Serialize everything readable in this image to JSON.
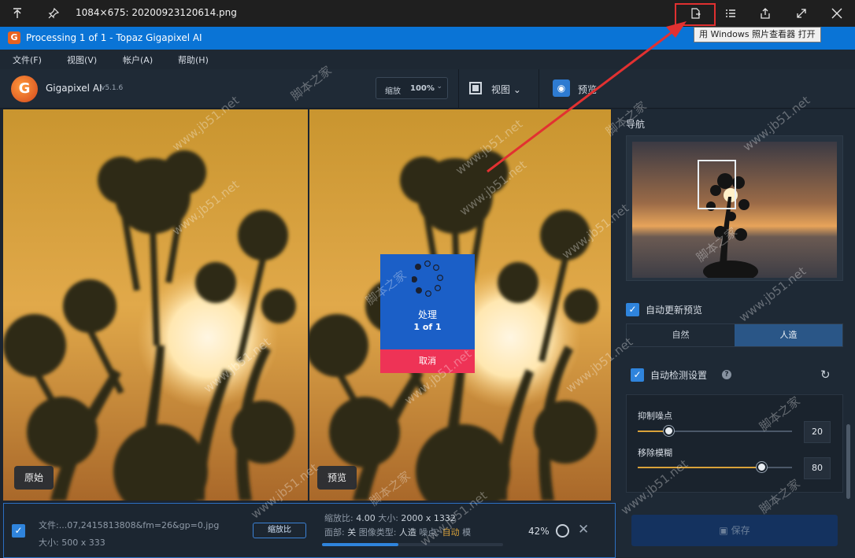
{
  "viewer": {
    "title": "1084×675: 20200923120614.png",
    "tooltip": "用 Windows 照片查看器 打开",
    "icons": [
      "upload-icon",
      "pin-icon",
      "open-with-icon",
      "list-icon",
      "share-icon",
      "expand-icon",
      "close-icon"
    ]
  },
  "window": {
    "title": "Processing 1 of 1 - Topaz Gigapixel AI"
  },
  "menu": {
    "items": [
      "文件(F)",
      "视图(V)",
      "帐户(A)",
      "帮助(H)"
    ]
  },
  "toolbar": {
    "brand": "Gigapixel AI",
    "version": "v5.1.6",
    "zoom_label": "缩放",
    "zoom_value": "100%",
    "view_label": "视图",
    "preview_label": "预览"
  },
  "panes": {
    "original_label": "原始",
    "preview_label": "预览"
  },
  "processing": {
    "label": "处理",
    "count": "1 of 1",
    "cancel": "取消"
  },
  "side": {
    "nav_title": "导航",
    "auto_update_preview": "自动更新预览",
    "auto_update_checked": true,
    "modes": [
      "自然",
      "人造"
    ],
    "active_mode": "人造",
    "auto_detect_settings": "自动检测设置",
    "auto_detect_checked": true,
    "sliders": [
      {
        "label": "抑制噪点",
        "value": "20",
        "fraction": 0.2
      },
      {
        "label": "移除模糊",
        "value": "80",
        "fraction": 0.8
      }
    ],
    "save": "保存"
  },
  "file": {
    "checked": true,
    "name": "文件:...07,2415813808&fm=26&gp=0.jpg",
    "size": "大小: 500 x 333",
    "scale_button": "缩放比",
    "scale_prefix": "缩放比: ",
    "scale_value": "4.00",
    "out_size_prefix": "大小: ",
    "out_size_value": "2000 x 1332",
    "face_prefix": "面部: ",
    "face_value": "关",
    "image_type_prefix": "图像类型: ",
    "image_type_value": "人造",
    "noise_prefix": "噪点: ",
    "noise_value": "自动",
    "model_prefix": "模",
    "progress_text": "42%",
    "progress_fraction": 0.42
  },
  "watermarks": [
    "www.jb51.net",
    "脚本之家"
  ],
  "colors": {
    "accent": "#2f84dc",
    "title_bar": "#0a74d6",
    "cancel": "#ee3356",
    "highlight": "#e03030",
    "slider": "#d9a23a"
  }
}
